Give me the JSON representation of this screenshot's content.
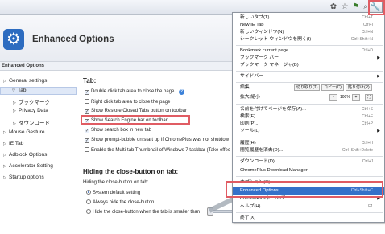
{
  "toolbar": {
    "icons": [
      "addon-icon",
      "star-icon",
      "share-icon",
      "search-icon",
      "wrench-icon"
    ]
  },
  "header": {
    "title": "Enhanced Options",
    "subheader": "Enhanced Options"
  },
  "sidebar": {
    "items": [
      {
        "label": "General settings",
        "selected": false
      },
      {
        "label": "Tab",
        "selected": true
      },
      {
        "label": "ブックマーク",
        "selected": false
      },
      {
        "label": "Privacy Data",
        "selected": false
      },
      {
        "label": "ダウンロード",
        "selected": false
      },
      {
        "label": "Mouse Gesture",
        "selected": false
      },
      {
        "label": "IE Tab",
        "selected": false
      },
      {
        "label": "Adblock Options",
        "selected": false
      },
      {
        "label": "Accelerator Setting",
        "selected": false
      },
      {
        "label": "Startup options",
        "selected": false
      }
    ]
  },
  "main": {
    "tab_section_title": "Tab:",
    "checkboxes": [
      {
        "label": "Double click tab area to close the page.",
        "checked": true
      },
      {
        "label": "Right click tab area to close the page",
        "checked": false
      },
      {
        "label": "Show Restore Closed Tabs button on toolbar",
        "checked": true
      },
      {
        "label": "Show Search Engine bar on toolbar",
        "checked": true
      },
      {
        "label": "Show search box in new tab",
        "checked": true
      },
      {
        "label": "Show prompt-bubble on start up if ChromePlus was not shutdow",
        "checked": true
      },
      {
        "label": "Enable the Multi-tab Thumbnail of Windows 7 taskbar (Take effec",
        "checked": false
      }
    ],
    "hide_section_title": "Hiding the close-button on tab:",
    "hide_desc": "Hiding the close-button on tab:",
    "radios": [
      {
        "label": "System default setting",
        "checked": true
      },
      {
        "label": "Always hide the close-button",
        "checked": false
      },
      {
        "label": "Hide the close-button when the tab is smaller than",
        "checked": false
      }
    ]
  },
  "menu": {
    "items": [
      {
        "label": "新しいタブ(T)",
        "shortcut": "Ctrl+T"
      },
      {
        "label": "New IE Tab",
        "shortcut": "Ctrl+I"
      },
      {
        "label": "新しいウィンドウ(N)",
        "shortcut": "Ctrl+N"
      },
      {
        "label": "シークレット ウィンドウを開く(I)",
        "shortcut": "Ctrl+Shift+N"
      },
      {
        "label": "Bookmark current page",
        "shortcut": "Ctrl+D"
      },
      {
        "label": "ブックマーク バー",
        "shortcut": ""
      },
      {
        "label": "ブックマーク マネージャ(B)",
        "shortcut": ""
      },
      {
        "label": "サイドバー",
        "shortcut": ""
      },
      {
        "label": "編集",
        "shortcut": ""
      },
      {
        "label": "拡大/縮小",
        "shortcut": ""
      },
      {
        "label": "名前を付けてページを保存(A)...",
        "shortcut": "Ctrl+S"
      },
      {
        "label": "検索(F)...",
        "shortcut": "Ctrl+F"
      },
      {
        "label": "印刷(P)...",
        "shortcut": "Ctrl+P"
      },
      {
        "label": "ツール(L)",
        "shortcut": ""
      },
      {
        "label": "履歴(H)",
        "shortcut": "Ctrl+H"
      },
      {
        "label": "閲覧履歴を消去(D)...",
        "shortcut": "Ctrl+Shift+Delete"
      },
      {
        "label": "ダウンロード(D)",
        "shortcut": "Ctrl+J"
      },
      {
        "label": "ChromePlus Download Manager",
        "shortcut": ""
      },
      {
        "label": "オプション(O)",
        "shortcut": ""
      },
      {
        "label": "Enhanced Options",
        "shortcut": "Ctrl+Shift+C"
      },
      {
        "label": "ChromePlus について",
        "shortcut": ""
      },
      {
        "label": "ヘルプ(H)",
        "shortcut": "F1"
      },
      {
        "label": "終了(X)",
        "shortcut": ""
      }
    ],
    "edit_cut": "切り取り(T)",
    "edit_copy": "コピー(C)",
    "edit_paste": "貼り付け(P)",
    "zoom_minus": "-",
    "zoom_value": "100%",
    "zoom_plus": "+"
  }
}
